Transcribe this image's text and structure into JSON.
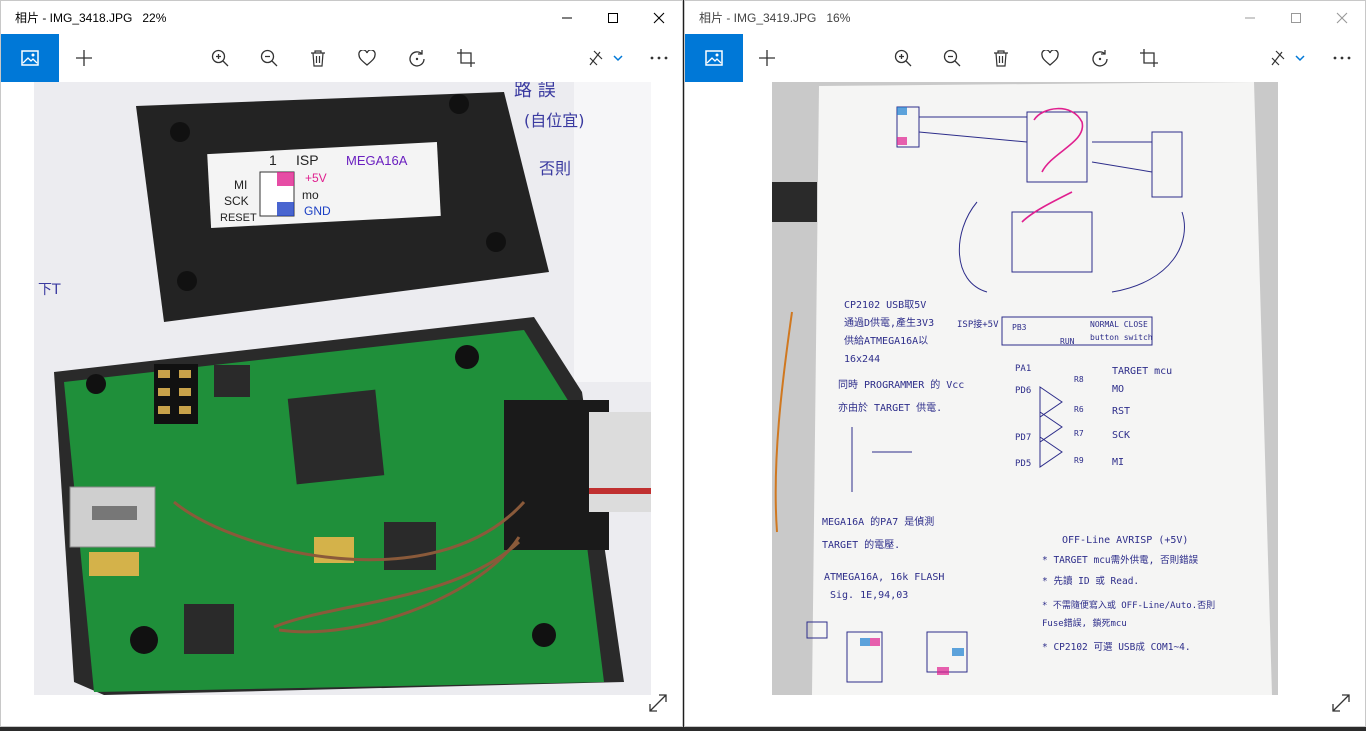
{
  "colors": {
    "accent": "#0078d7",
    "pcb_green": "#1f8f3a",
    "ink_blue": "#2d2d8a",
    "ink_pink": "#e0208f"
  },
  "windows": [
    {
      "title": "相片 - IMG_3418.JPG   22%",
      "active": true,
      "toolbar": {
        "tile_icon": "photo-icon",
        "add_icon": "plus-icon",
        "zoom_in_icon": "zoom-in-icon",
        "zoom_out_icon": "zoom-out-icon",
        "delete_icon": "trash-icon",
        "favorite_icon": "heart-icon",
        "rotate_icon": "rotate-icon",
        "crop_icon": "crop-icon",
        "edit_icon": "edit-create-icon",
        "more_icon": "more-icon"
      },
      "photo_labels": {
        "isp_header": "ISP",
        "isp_pin1": "1",
        "chip": "MEGA16A",
        "mi": "MI",
        "mo": "mo",
        "sck": "SCK",
        "reset": "RESET",
        "v5": "+5V",
        "gnd": "GND"
      }
    },
    {
      "title": "相片 - IMG_3419.JPG   16%",
      "active": false,
      "photo_notes": [
        "CP2102  USB取5V",
        "通過D供電,產生3V3",
        "供給ATMEGA16A以",
        "16x244",
        "同時 PROGRAMMER 的 Vcc",
        "亦由於 TARGET 供電.",
        "MEGA16A 的PA7 是偵測",
        "TARGET 的電壓.",
        "ATMEGA16A, 16k FLASH",
        "Sig. 1E,94,03",
        "OFF-Line AVRISP    (+5V)",
        "* TARGET mcu需外供電, 否則錯誤",
        "* 先讀 ID 或 Read.",
        "* 不需隨便寫入或 OFF-Line/Auto.否則",
        "   Fuse錯誤, 鎖死mcu",
        "* CP2102 可選 USB成 COM1~4.",
        "TARGET mcu",
        "MO",
        "RST",
        "SCK",
        "MI",
        "PA1",
        "PD6",
        "PD7",
        "PD5",
        "R8",
        "R6",
        "R7",
        "R9",
        "NORMAL CLOSE",
        "button switch",
        "RUN",
        "PB3",
        "ISP接+5V"
      ]
    }
  ]
}
